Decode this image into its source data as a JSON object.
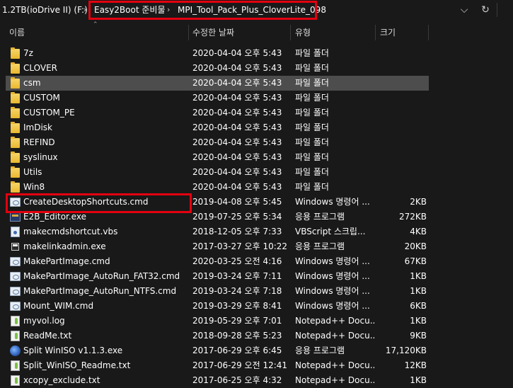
{
  "address": {
    "drive": "1.2TB(ioDrive II) (F:)",
    "folder1": "Easy2Boot 준비물",
    "folder2": "MPI_Tool_Pack_Plus_CloverLite_098"
  },
  "columns": {
    "name": "이름",
    "date": "수정한 날짜",
    "type": "유형",
    "size": "크기"
  },
  "files": [
    {
      "name": "7z",
      "date": "2020-04-04 오후 5:43",
      "type": "파일 폴더",
      "size": "",
      "icon": "folder-icon"
    },
    {
      "name": "CLOVER",
      "date": "2020-04-04 오후 5:43",
      "type": "파일 폴더",
      "size": "",
      "icon": "folder-icon"
    },
    {
      "name": "csm",
      "date": "2020-04-04 오후 5:43",
      "type": "파일 폴더",
      "size": "",
      "icon": "folder-icon"
    },
    {
      "name": "CUSTOM",
      "date": "2020-04-04 오후 5:43",
      "type": "파일 폴더",
      "size": "",
      "icon": "folder-icon"
    },
    {
      "name": "CUSTOM_PE",
      "date": "2020-04-04 오후 5:43",
      "type": "파일 폴더",
      "size": "",
      "icon": "folder-icon"
    },
    {
      "name": "ImDisk",
      "date": "2020-04-04 오후 5:43",
      "type": "파일 폴더",
      "size": "",
      "icon": "folder-icon"
    },
    {
      "name": "REFIND",
      "date": "2020-04-04 오후 5:43",
      "type": "파일 폴더",
      "size": "",
      "icon": "folder-icon"
    },
    {
      "name": "syslinux",
      "date": "2020-04-04 오후 5:43",
      "type": "파일 폴더",
      "size": "",
      "icon": "folder-icon"
    },
    {
      "name": "Utils",
      "date": "2020-04-04 오후 5:43",
      "type": "파일 폴더",
      "size": "",
      "icon": "folder-icon"
    },
    {
      "name": "Win8",
      "date": "2020-04-04 오후 5:43",
      "type": "파일 폴더",
      "size": "",
      "icon": "folder-icon"
    },
    {
      "name": "CreateDesktopShortcuts.cmd",
      "date": "2019-04-08 오후 5:45",
      "type": "Windows 명령어 ...",
      "size": "2KB",
      "icon": "cmd-file-icon"
    },
    {
      "name": "E2B_Editor.exe",
      "date": "2019-07-25 오후 5:34",
      "type": "응용 프로그램",
      "size": "272KB",
      "icon": "exe-icon"
    },
    {
      "name": "makecmdshortcut.vbs",
      "date": "2018-12-05 오후 7:33",
      "type": "VBScript 스크립...",
      "size": "4KB",
      "icon": "vbs-icon"
    },
    {
      "name": "makelinkadmin.exe",
      "date": "2017-03-27 오후 10:22",
      "type": "응용 프로그램",
      "size": "20KB",
      "icon": "mini-exe-icon"
    },
    {
      "name": "MakePartImage.cmd",
      "date": "2020-03-25 오전 4:16",
      "type": "Windows 명령어 ...",
      "size": "67KB",
      "icon": "cmd-file-icon"
    },
    {
      "name": "MakePartImage_AutoRun_FAT32.cmd",
      "date": "2019-03-24 오후 7:11",
      "type": "Windows 명령어 ...",
      "size": "1KB",
      "icon": "cmd-file-icon"
    },
    {
      "name": "MakePartImage_AutoRun_NTFS.cmd",
      "date": "2019-03-24 오후 7:18",
      "type": "Windows 명령어 ...",
      "size": "1KB",
      "icon": "cmd-file-icon"
    },
    {
      "name": "Mount_WIM.cmd",
      "date": "2019-03-29 오후 8:41",
      "type": "Windows 명령어 ...",
      "size": "6KB",
      "icon": "cmd-file-icon"
    },
    {
      "name": "myvol.log",
      "date": "2019-05-29 오후 7:01",
      "type": "Notepad++ Docu...",
      "size": "1KB",
      "icon": "notepad-doc-icon"
    },
    {
      "name": "ReadMe.txt",
      "date": "2018-09-28 오후 5:23",
      "type": "Notepad++ Docu...",
      "size": "9KB",
      "icon": "notepad-doc-icon"
    },
    {
      "name": "Split WinISO v1.1.3.exe",
      "date": "2017-06-29 오후 6:45",
      "type": "응용 프로그램",
      "size": "17,120KB",
      "icon": "splitiso-app-icon"
    },
    {
      "name": "Split_WinISO_Readme.txt",
      "date": "2017-06-29 오전 12:41",
      "type": "Notepad++ Docu...",
      "size": "12KB",
      "icon": "notepad-doc-icon"
    },
    {
      "name": "xcopy_exclude.txt",
      "date": "2017-06-25 오후 4:32",
      "type": "Notepad++ Docu...",
      "size": "1KB",
      "icon": "notepad-doc-icon"
    }
  ],
  "colors": {
    "background": "#191919",
    "selected_row": "#4d4d4d",
    "highlight_box": "#e3000f",
    "text": "#ffffff"
  }
}
